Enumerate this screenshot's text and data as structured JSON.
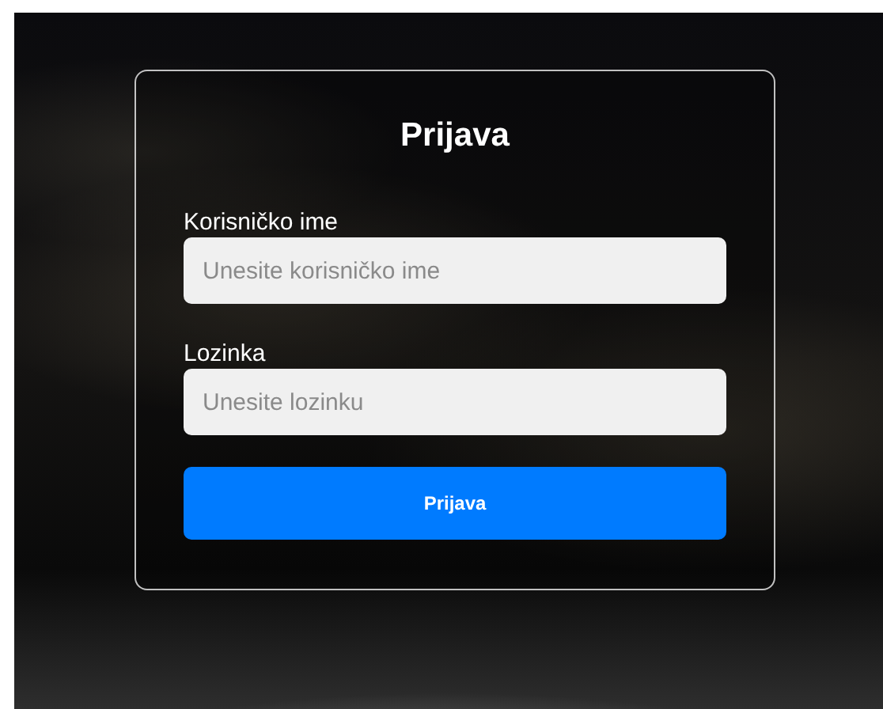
{
  "login_form": {
    "title": "Prijava",
    "fields": [
      {
        "label": "Korisničko ime",
        "placeholder": "Unesite korisničko ime"
      },
      {
        "label": "Lozinka",
        "placeholder": "Unesite lozinku"
      }
    ],
    "submit_button": "Prijava"
  }
}
